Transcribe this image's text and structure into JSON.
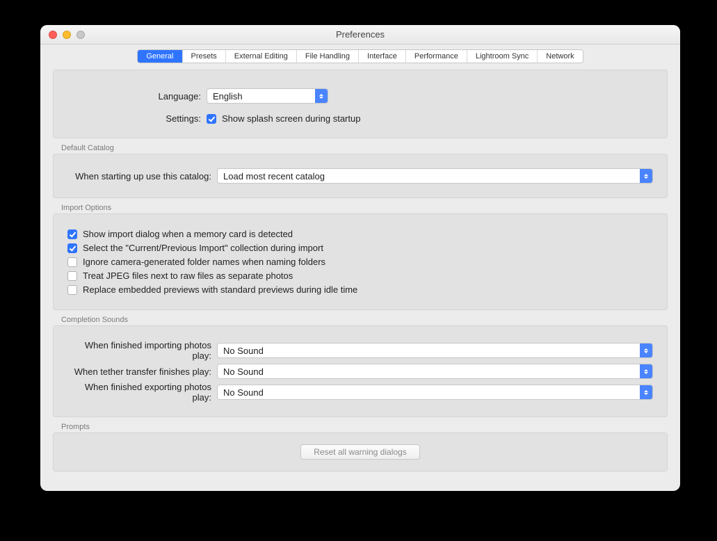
{
  "window": {
    "title": "Preferences"
  },
  "tabs": [
    {
      "label": "General",
      "active": true
    },
    {
      "label": "Presets",
      "active": false
    },
    {
      "label": "External Editing",
      "active": false
    },
    {
      "label": "File Handling",
      "active": false
    },
    {
      "label": "Interface",
      "active": false
    },
    {
      "label": "Performance",
      "active": false
    },
    {
      "label": "Lightroom Sync",
      "active": false
    },
    {
      "label": "Network",
      "active": false
    }
  ],
  "general": {
    "language_label": "Language:",
    "language_value": "English",
    "settings_label": "Settings:",
    "splash_checkbox": {
      "label": "Show splash screen during startup",
      "checked": true
    }
  },
  "default_catalog": {
    "section": "Default Catalog",
    "label": "When starting up use this catalog:",
    "value": "Load most recent catalog"
  },
  "import_options": {
    "section": "Import Options",
    "items": [
      {
        "label": "Show import dialog when a memory card is detected",
        "checked": true
      },
      {
        "label": "Select the \"Current/Previous Import\" collection during import",
        "checked": true
      },
      {
        "label": "Ignore camera-generated folder names when naming folders",
        "checked": false
      },
      {
        "label": "Treat JPEG files next to raw files as separate photos",
        "checked": false
      },
      {
        "label": "Replace embedded previews with standard previews during idle time",
        "checked": false
      }
    ]
  },
  "completion_sounds": {
    "section": "Completion Sounds",
    "rows": [
      {
        "label": "When finished importing photos play:",
        "value": "No Sound"
      },
      {
        "label": "When tether transfer finishes play:",
        "value": "No Sound"
      },
      {
        "label": "When finished exporting photos play:",
        "value": "No Sound"
      }
    ]
  },
  "prompts": {
    "section": "Prompts",
    "reset_button": "Reset all warning dialogs"
  }
}
